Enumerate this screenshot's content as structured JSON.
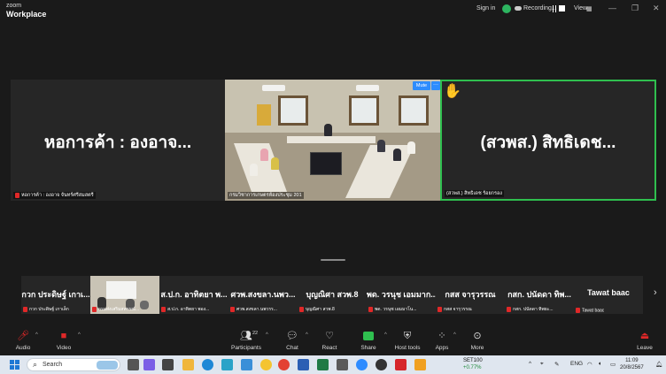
{
  "titlebar": {
    "logo_line1": "zoom",
    "logo_line2": "Workplace",
    "sign_in": "Sign in",
    "recording": "Recording...",
    "view": "View"
  },
  "tiles": [
    {
      "big_name": "หอการค้า : องอาจ...",
      "caption": "หอการค้า : องอาจ จันทร์ศรีสมสตรี"
    },
    {
      "caption": "กรมวิชาการเกษตรห้องประชุม 201"
    },
    {
      "big_name": "(สวพส.) สิทธิเดช...",
      "caption": "(สวพส.) สิทธิเดช ร้อยกรอง"
    }
  ],
  "video_controls": {
    "mute": "Mute",
    "more": "···"
  },
  "gallery": [
    {
      "name": "กวก ประดิษฐ์ เกาเ...",
      "caption": "กวก ประดิษฐ์ เกาเล็ก"
    },
    {
      "name": "",
      "caption": "กรมส่งเสริมสหกรณ์..."
    },
    {
      "name": "ส.ป.ก. อาทิตยา พ...",
      "caption": "ส.ป.ก. อาทิตยา พอง..."
    },
    {
      "name": "ศวพ.สงขลา.นพว...",
      "caption": "ศวพ.สงขลา.นพวรร..."
    },
    {
      "name": "บุญณิศา สวพ.8",
      "caption": "บุญณิศา สวพ.8"
    },
    {
      "name": "พด. วรนุช เอมมาก...",
      "caption": "พด. วรนุช เอมมาโน..."
    },
    {
      "name": "กสส จารุวรรณ",
      "caption": "กสส จารุวรรณ"
    },
    {
      "name": "กสก. ปนัดดา ทิพ...",
      "caption": "กสก. ปนัดดา ทิพยะ..."
    },
    {
      "name": "Tawat baac",
      "caption": "Tawat baac"
    }
  ],
  "toolbar": {
    "audio": "Audio",
    "video": "Video",
    "participants": "Participants",
    "participants_count": "22",
    "chat": "Chat",
    "react": "React",
    "share": "Share",
    "host_tools": "Host tools",
    "apps": "Apps",
    "more": "More",
    "leave": "Leave"
  },
  "taskbar": {
    "search_placeholder": "Search",
    "stock_name": "SET100",
    "stock_change": "+0.77%",
    "language": "ENG",
    "time": "11:09",
    "date": "20/8/2567"
  },
  "colors": {
    "active_speaker_border": "#2fbf4f",
    "mute_button": "#2d8cff",
    "muted_mic": "#e02828",
    "hand_raise": "#f5c518"
  }
}
